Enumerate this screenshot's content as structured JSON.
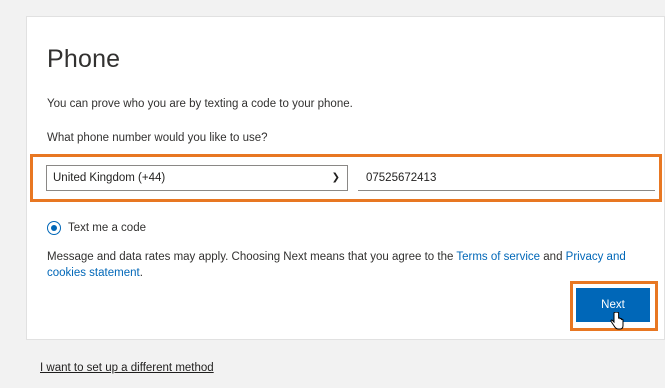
{
  "page": {
    "title": "Phone",
    "description": "You can prove who you are by texting a code to your phone.",
    "question": "What phone number would you like to use?"
  },
  "form": {
    "country_value": "United Kingdom (+44)",
    "phone_value": "07525672413",
    "method_label": "Text me a code"
  },
  "terms": {
    "prefix": "Message and data rates may apply. Choosing Next means that you agree to the ",
    "terms_link": "Terms of service",
    "and": " and ",
    "privacy_link": "Privacy and cookies statement",
    "suffix": "."
  },
  "actions": {
    "next_label": "Next",
    "alt_method": "I want to set up a different method"
  },
  "colors": {
    "accent": "#0067b8",
    "highlight": "#e87722"
  },
  "icons": {
    "dropdown": "chevron-down-icon",
    "cursor": "hand-cursor-icon"
  }
}
